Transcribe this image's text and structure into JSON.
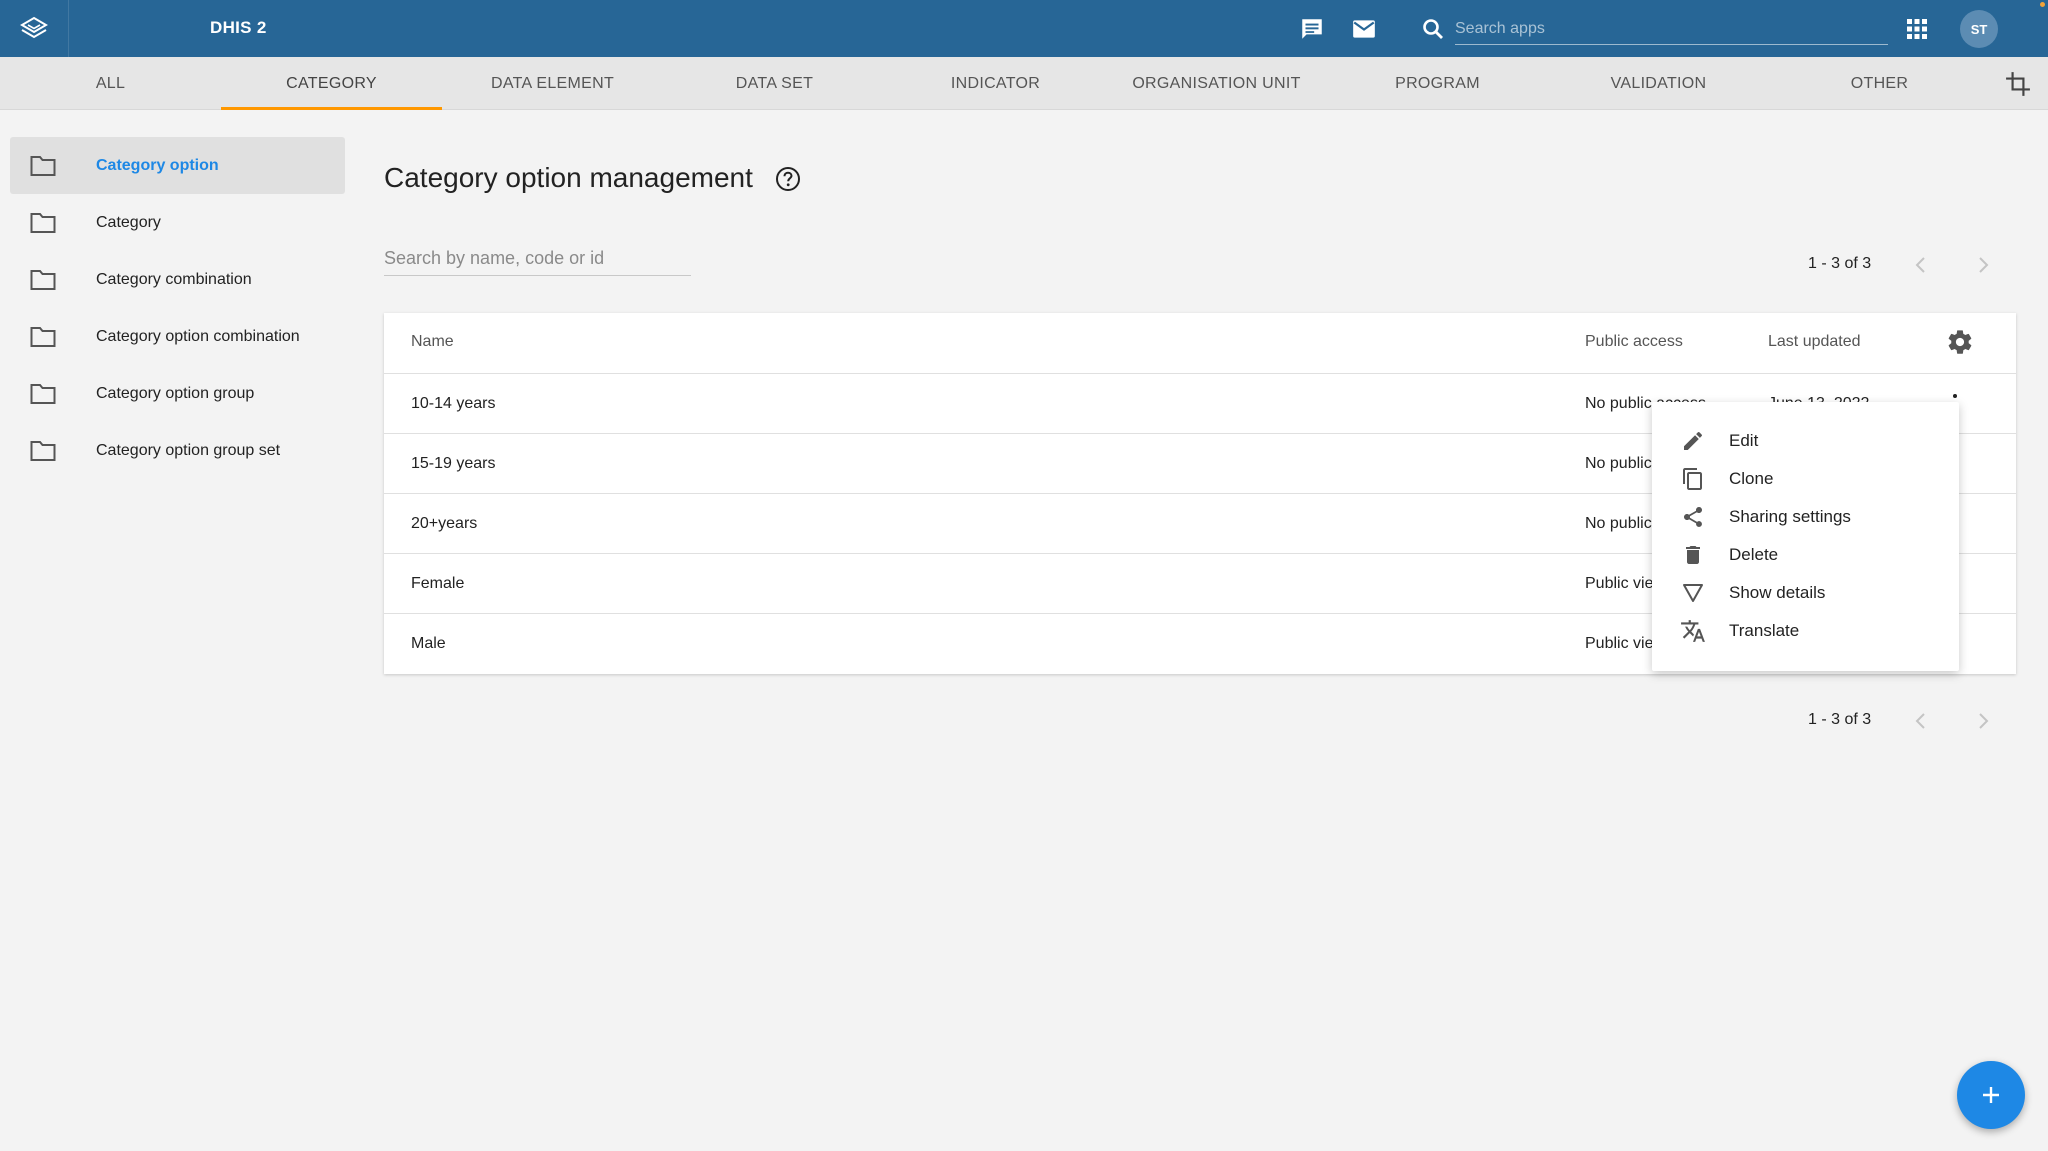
{
  "header": {
    "app_title": "DHIS 2",
    "search_placeholder": "Search apps",
    "avatar_initials": "ST",
    "icons": [
      "dhis2-logo-icon",
      "messages-icon",
      "mail-icon",
      "search-icon",
      "apps-grid-icon"
    ]
  },
  "tabs": [
    {
      "label": "ALL"
    },
    {
      "label": "CATEGORY",
      "active": true
    },
    {
      "label": "DATA ELEMENT"
    },
    {
      "label": "DATA SET"
    },
    {
      "label": "INDICATOR"
    },
    {
      "label": "ORGANISATION UNIT"
    },
    {
      "label": "PROGRAM"
    },
    {
      "label": "VALIDATION"
    },
    {
      "label": "OTHER"
    }
  ],
  "sidebar": {
    "items": [
      {
        "label": "Category option",
        "active": true
      },
      {
        "label": "Category"
      },
      {
        "label": "Category combination"
      },
      {
        "label": "Category option combination"
      },
      {
        "label": "Category option group"
      },
      {
        "label": "Category option group set"
      }
    ]
  },
  "main": {
    "title": "Category option management",
    "search_placeholder": "Search by name, code or id",
    "pager_top": "1 - 3 of 3",
    "pager_bottom": "1 - 3 of 3"
  },
  "table": {
    "columns": {
      "name": "Name",
      "public_access": "Public access",
      "last_updated": "Last updated"
    },
    "rows": [
      {
        "name": "10-14 years",
        "public_access": "No public access",
        "last_updated": "June 13, 2022"
      },
      {
        "name": "15-19 years",
        "public_access": "No public",
        "last_updated": ""
      },
      {
        "name": "20+years",
        "public_access": "No public",
        "last_updated": ""
      },
      {
        "name": "Female",
        "public_access": "Public vie",
        "last_updated": ""
      },
      {
        "name": "Male",
        "public_access": "Public vie",
        "last_updated": ""
      }
    ]
  },
  "context_menu": {
    "items": [
      {
        "label": "Edit",
        "icon": "edit-icon"
      },
      {
        "label": "Clone",
        "icon": "clone-icon"
      },
      {
        "label": "Sharing settings",
        "icon": "share-icon"
      },
      {
        "label": "Delete",
        "icon": "delete-icon"
      },
      {
        "label": "Show details",
        "icon": "show-details-icon"
      },
      {
        "label": "Translate",
        "icon": "translate-icon"
      }
    ]
  },
  "colors": {
    "header_bg": "#276696",
    "tab_active_indicator": "#ff9800",
    "accent_blue": "#1e88e5"
  }
}
